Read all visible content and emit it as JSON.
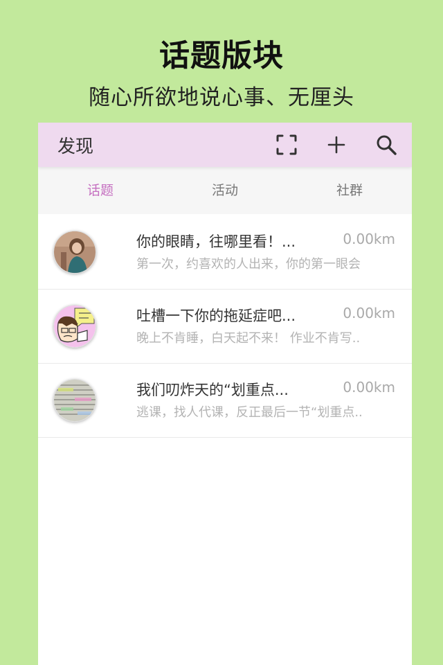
{
  "promo": {
    "title": "话题版块",
    "subtitle": "随心所欲地说心事、无厘头"
  },
  "topbar": {
    "title": "发现",
    "icons": [
      "scan-icon",
      "plus-icon",
      "search-icon"
    ]
  },
  "tabs": [
    {
      "label": "话题",
      "active": true
    },
    {
      "label": "活动",
      "active": false
    },
    {
      "label": "社群",
      "active": false
    }
  ],
  "topics": [
    {
      "title": "你的眼睛，往哪里看！...",
      "distance": "0.00km",
      "description": "第一次，约喜欢的人出来，你的第一眼会",
      "avatar": "girl-photo-avatar"
    },
    {
      "title": "吐槽一下你的拖延症吧...",
      "distance": "0.00km",
      "description": "晚上不肯睡，白天起不来！ 作业不肯写..",
      "avatar": "cartoon-avatar"
    },
    {
      "title": "我们叨炸天的“划重点...",
      "distance": "0.00km",
      "description": "逃课，找人代课，反正最后一节“划重点..",
      "avatar": "notes-photo-avatar"
    }
  ],
  "colors": {
    "background": "#c2e99c",
    "topbar": "#efdaef",
    "tab_active": "#c56fc0"
  }
}
